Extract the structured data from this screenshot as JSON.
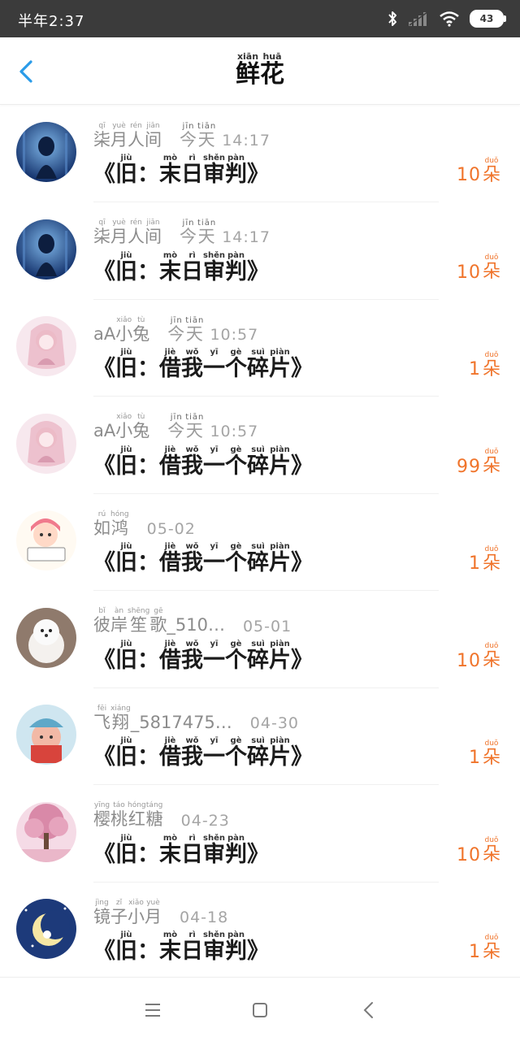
{
  "status_bar": {
    "time": "半年2:37",
    "battery": "43",
    "icons": [
      "bluetooth-icon",
      "signal-icon",
      "wifi-icon",
      "battery-icon"
    ]
  },
  "header": {
    "title_chars": [
      {
        "ch": "鲜",
        "py": "xiān"
      },
      {
        "ch": "花",
        "py": "huā"
      }
    ]
  },
  "colors": {
    "count_accent": "#f0742b",
    "back_arrow": "#2a9be8"
  },
  "items": [
    {
      "avatar": "avatar-blue-girl",
      "name_chars": [
        {
          "ch": "柒",
          "py": "qī"
        },
        {
          "ch": "月",
          "py": "yuè"
        },
        {
          "ch": "人",
          "py": "rén"
        },
        {
          "ch": "间",
          "py": "jiān"
        }
      ],
      "time_chars": [
        {
          "ch": "今",
          "py": "jīn"
        },
        {
          "ch": "天",
          "py": "tiān"
        }
      ],
      "time_text": "14:17",
      "message_chars": [
        {
          "ch": "《",
          "py": ""
        },
        {
          "ch": "旧",
          "py": "jiù"
        },
        {
          "ch": "：",
          "py": ""
        },
        {
          "ch": "末",
          "py": "mò"
        },
        {
          "ch": "日",
          "py": "rì"
        },
        {
          "ch": "审",
          "py": "shěn"
        },
        {
          "ch": "判",
          "py": "pàn"
        },
        {
          "ch": "》",
          "py": ""
        }
      ],
      "count": "10",
      "unit": {
        "ch": "朵",
        "py": "duǒ"
      }
    },
    {
      "avatar": "avatar-blue-girl",
      "name_chars": [
        {
          "ch": "柒",
          "py": "qī"
        },
        {
          "ch": "月",
          "py": "yuè"
        },
        {
          "ch": "人",
          "py": "rén"
        },
        {
          "ch": "间",
          "py": "jiān"
        }
      ],
      "time_chars": [
        {
          "ch": "今",
          "py": "jīn"
        },
        {
          "ch": "天",
          "py": "tiān"
        }
      ],
      "time_text": "14:17",
      "message_chars": [
        {
          "ch": "《",
          "py": ""
        },
        {
          "ch": "旧",
          "py": "jiù"
        },
        {
          "ch": "：",
          "py": ""
        },
        {
          "ch": "末",
          "py": "mò"
        },
        {
          "ch": "日",
          "py": "rì"
        },
        {
          "ch": "审",
          "py": "shěn"
        },
        {
          "ch": "判",
          "py": "pàn"
        },
        {
          "ch": "》",
          "py": ""
        }
      ],
      "count": "10",
      "unit": {
        "ch": "朵",
        "py": "duǒ"
      }
    },
    {
      "avatar": "avatar-pink-anime",
      "name_chars": [
        {
          "ch": "aA",
          "py": ""
        },
        {
          "ch": "小",
          "py": "xiǎo"
        },
        {
          "ch": "兔",
          "py": "tù"
        }
      ],
      "time_chars": [
        {
          "ch": "今",
          "py": "jīn"
        },
        {
          "ch": "天",
          "py": "tiān"
        }
      ],
      "time_text": "10:57",
      "message_chars": [
        {
          "ch": "《",
          "py": ""
        },
        {
          "ch": "旧",
          "py": "jiù"
        },
        {
          "ch": "：",
          "py": ""
        },
        {
          "ch": "借",
          "py": "jiè"
        },
        {
          "ch": "我",
          "py": "wǒ"
        },
        {
          "ch": "一",
          "py": "yī"
        },
        {
          "ch": "个",
          "py": "gè"
        },
        {
          "ch": "碎",
          "py": "suì"
        },
        {
          "ch": "片",
          "py": "piàn"
        },
        {
          "ch": "》",
          "py": ""
        }
      ],
      "count": "1",
      "unit": {
        "ch": "朵",
        "py": "duǒ"
      }
    },
    {
      "avatar": "avatar-pink-anime",
      "name_chars": [
        {
          "ch": "aA",
          "py": ""
        },
        {
          "ch": "小",
          "py": "xiǎo"
        },
        {
          "ch": "兔",
          "py": "tù"
        }
      ],
      "time_chars": [
        {
          "ch": "今",
          "py": "jīn"
        },
        {
          "ch": "天",
          "py": "tiān"
        }
      ],
      "time_text": "10:57",
      "message_chars": [
        {
          "ch": "《",
          "py": ""
        },
        {
          "ch": "旧",
          "py": "jiù"
        },
        {
          "ch": "：",
          "py": ""
        },
        {
          "ch": "借",
          "py": "jiè"
        },
        {
          "ch": "我",
          "py": "wǒ"
        },
        {
          "ch": "一",
          "py": "yī"
        },
        {
          "ch": "个",
          "py": "gè"
        },
        {
          "ch": "碎",
          "py": "suì"
        },
        {
          "ch": "片",
          "py": "piàn"
        },
        {
          "ch": "》",
          "py": ""
        }
      ],
      "count": "99",
      "unit": {
        "ch": "朵",
        "py": "duǒ"
      }
    },
    {
      "avatar": "avatar-cartoon-girl",
      "name_chars": [
        {
          "ch": "如",
          "py": "rú"
        },
        {
          "ch": "鸿",
          "py": "hóng"
        }
      ],
      "time_chars": [],
      "time_text": "05-02",
      "message_chars": [
        {
          "ch": "《",
          "py": ""
        },
        {
          "ch": "旧",
          "py": "jiù"
        },
        {
          "ch": "：",
          "py": ""
        },
        {
          "ch": "借",
          "py": "jiè"
        },
        {
          "ch": "我",
          "py": "wǒ"
        },
        {
          "ch": "一",
          "py": "yī"
        },
        {
          "ch": "个",
          "py": "gè"
        },
        {
          "ch": "碎",
          "py": "suì"
        },
        {
          "ch": "片",
          "py": "piàn"
        },
        {
          "ch": "》",
          "py": ""
        }
      ],
      "count": "1",
      "unit": {
        "ch": "朵",
        "py": "duǒ"
      }
    },
    {
      "avatar": "avatar-white-dog",
      "name_chars": [
        {
          "ch": "彼",
          "py": "bǐ"
        },
        {
          "ch": "岸",
          "py": "àn"
        },
        {
          "ch": "笙",
          "py": "shēng"
        },
        {
          "ch": "歌",
          "py": "gē"
        },
        {
          "ch": "_510…",
          "py": ""
        }
      ],
      "time_chars": [],
      "time_text": "05-01",
      "message_chars": [
        {
          "ch": "《",
          "py": ""
        },
        {
          "ch": "旧",
          "py": "jiù"
        },
        {
          "ch": "：",
          "py": ""
        },
        {
          "ch": "借",
          "py": "jiè"
        },
        {
          "ch": "我",
          "py": "wǒ"
        },
        {
          "ch": "一",
          "py": "yī"
        },
        {
          "ch": "个",
          "py": "gè"
        },
        {
          "ch": "碎",
          "py": "suì"
        },
        {
          "ch": "片",
          "py": "piàn"
        },
        {
          "ch": "》",
          "py": ""
        }
      ],
      "count": "10",
      "unit": {
        "ch": "朵",
        "py": "duǒ"
      }
    },
    {
      "avatar": "avatar-baby",
      "name_chars": [
        {
          "ch": "飞",
          "py": "fēi"
        },
        {
          "ch": "翔",
          "py": "xiáng"
        },
        {
          "ch": "_5817475…",
          "py": ""
        }
      ],
      "time_chars": [],
      "time_text": "04-30",
      "message_chars": [
        {
          "ch": "《",
          "py": ""
        },
        {
          "ch": "旧",
          "py": "jiù"
        },
        {
          "ch": "：",
          "py": ""
        },
        {
          "ch": "借",
          "py": "jiè"
        },
        {
          "ch": "我",
          "py": "wǒ"
        },
        {
          "ch": "一",
          "py": "yī"
        },
        {
          "ch": "个",
          "py": "gè"
        },
        {
          "ch": "碎",
          "py": "suì"
        },
        {
          "ch": "片",
          "py": "piàn"
        },
        {
          "ch": "》",
          "py": ""
        }
      ],
      "count": "1",
      "unit": {
        "ch": "朵",
        "py": "duǒ"
      }
    },
    {
      "avatar": "avatar-pink-tree",
      "name_chars": [
        {
          "ch": "樱",
          "py": "yīng"
        },
        {
          "ch": "桃",
          "py": "táo"
        },
        {
          "ch": "红",
          "py": "hóng"
        },
        {
          "ch": "糖",
          "py": "táng"
        }
      ],
      "time_chars": [],
      "time_text": "04-23",
      "message_chars": [
        {
          "ch": "《",
          "py": ""
        },
        {
          "ch": "旧",
          "py": "jiù"
        },
        {
          "ch": "：",
          "py": ""
        },
        {
          "ch": "末",
          "py": "mò"
        },
        {
          "ch": "日",
          "py": "rì"
        },
        {
          "ch": "审",
          "py": "shěn"
        },
        {
          "ch": "判",
          "py": "pàn"
        },
        {
          "ch": "》",
          "py": ""
        }
      ],
      "count": "10",
      "unit": {
        "ch": "朵",
        "py": "duǒ"
      }
    },
    {
      "avatar": "avatar-moon-night",
      "name_chars": [
        {
          "ch": "镜",
          "py": "jìng"
        },
        {
          "ch": "子",
          "py": "zǐ"
        },
        {
          "ch": "小",
          "py": "xiǎo"
        },
        {
          "ch": "月",
          "py": "yuè"
        }
      ],
      "time_chars": [],
      "time_text": "04-18",
      "message_chars": [
        {
          "ch": "《",
          "py": ""
        },
        {
          "ch": "旧",
          "py": "jiù"
        },
        {
          "ch": "：",
          "py": ""
        },
        {
          "ch": "末",
          "py": "mò"
        },
        {
          "ch": "日",
          "py": "rì"
        },
        {
          "ch": "审",
          "py": "shěn"
        },
        {
          "ch": "判",
          "py": "pàn"
        },
        {
          "ch": "》",
          "py": ""
        }
      ],
      "count": "1",
      "unit": {
        "ch": "朵",
        "py": "duǒ"
      }
    }
  ],
  "nav": [
    "menu-icon",
    "home-icon",
    "back-icon"
  ]
}
